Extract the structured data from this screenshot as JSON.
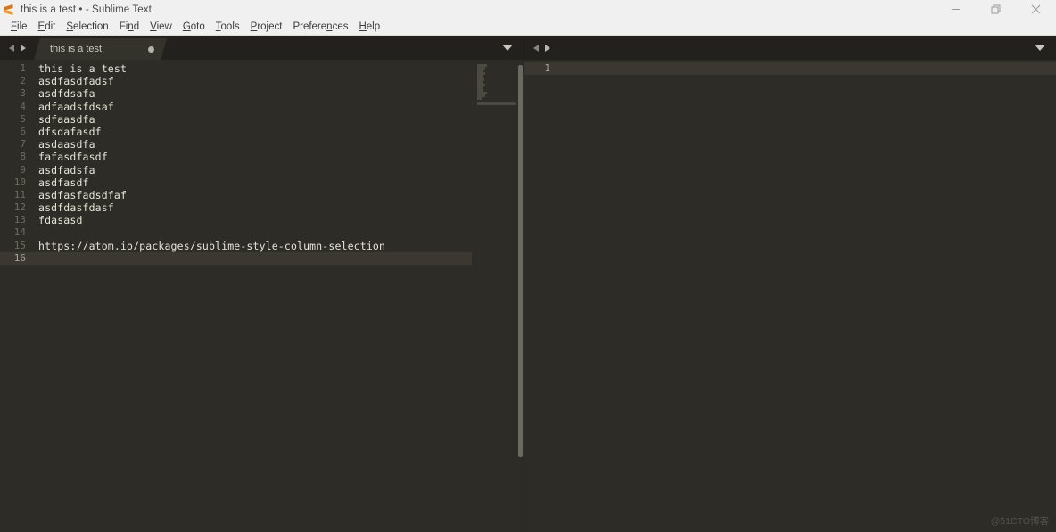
{
  "window": {
    "title": "this is a test • - Sublime Text",
    "app_logo_icon": "sublime-text-logo-icon",
    "controls": [
      {
        "name": "minimize",
        "icon": "minimize-icon"
      },
      {
        "name": "restore",
        "icon": "restore-icon"
      },
      {
        "name": "close",
        "icon": "close-icon"
      }
    ]
  },
  "menubar": {
    "items": [
      {
        "label": "File",
        "pre": "",
        "mnemonic": "F",
        "post": "ile"
      },
      {
        "label": "Edit",
        "pre": "",
        "mnemonic": "E",
        "post": "dit"
      },
      {
        "label": "Selection",
        "pre": "",
        "mnemonic": "S",
        "post": "election"
      },
      {
        "label": "Find",
        "pre": "Fi",
        "mnemonic": "n",
        "post": "d"
      },
      {
        "label": "View",
        "pre": "",
        "mnemonic": "V",
        "post": "iew"
      },
      {
        "label": "Goto",
        "pre": "",
        "mnemonic": "G",
        "post": "oto"
      },
      {
        "label": "Tools",
        "pre": "",
        "mnemonic": "T",
        "post": "ools"
      },
      {
        "label": "Project",
        "pre": "",
        "mnemonic": "P",
        "post": "roject"
      },
      {
        "label": "Preferences",
        "pre": "Prefere",
        "mnemonic": "n",
        "post": "ces"
      },
      {
        "label": "Help",
        "pre": "",
        "mnemonic": "H",
        "post": "elp"
      }
    ]
  },
  "panes": {
    "left": {
      "tab": {
        "label": "this is a test",
        "dirty": true,
        "dirty_icon": "unsaved-dot-icon"
      },
      "nav_prev_icon": "arrow-left-icon",
      "nav_next_icon": "arrow-right-icon",
      "tab_menu_icon": "chevron-down-icon",
      "line_numbers": [
        "1",
        "2",
        "3",
        "4",
        "5",
        "6",
        "7",
        "8",
        "9",
        "10",
        "11",
        "12",
        "13",
        "14",
        "15",
        "16"
      ],
      "active_line": 16,
      "lines": [
        "this is a test",
        "asdfasdfadsf",
        "asdfdsafa",
        "adfaadsfdsaf",
        "sdfaasdfa",
        "dfsdafasdf",
        "asdaasdfa",
        "fafasdfasdf",
        "asdfadsfa",
        "asdfasdf",
        "asdfasfadsdfaf",
        "asdfdasfdasf",
        "fdasasd",
        "",
        "https://atom.io/packages/sublime-style-column-selection",
        ""
      ]
    },
    "right": {
      "nav_prev_icon": "arrow-left-icon",
      "nav_next_icon": "arrow-right-icon",
      "tab_menu_icon": "chevron-down-icon",
      "line_numbers": [
        "1"
      ],
      "active_line": 1,
      "lines": [
        ""
      ]
    }
  },
  "watermark": {
    "text": "@51CTO博客"
  },
  "colors": {
    "editor_bg": "#2e2c26",
    "tabbar_bg": "#22211d",
    "active_tab_bg": "#33322b",
    "active_line_bg": "#3a3830",
    "text": "#e6e3d6",
    "gutter_text": "#6e6b5e",
    "titlebar_bg": "#f0f0f0",
    "logo_accent": "#f09a26",
    "scrollbar_thumb": "#6b6960"
  }
}
